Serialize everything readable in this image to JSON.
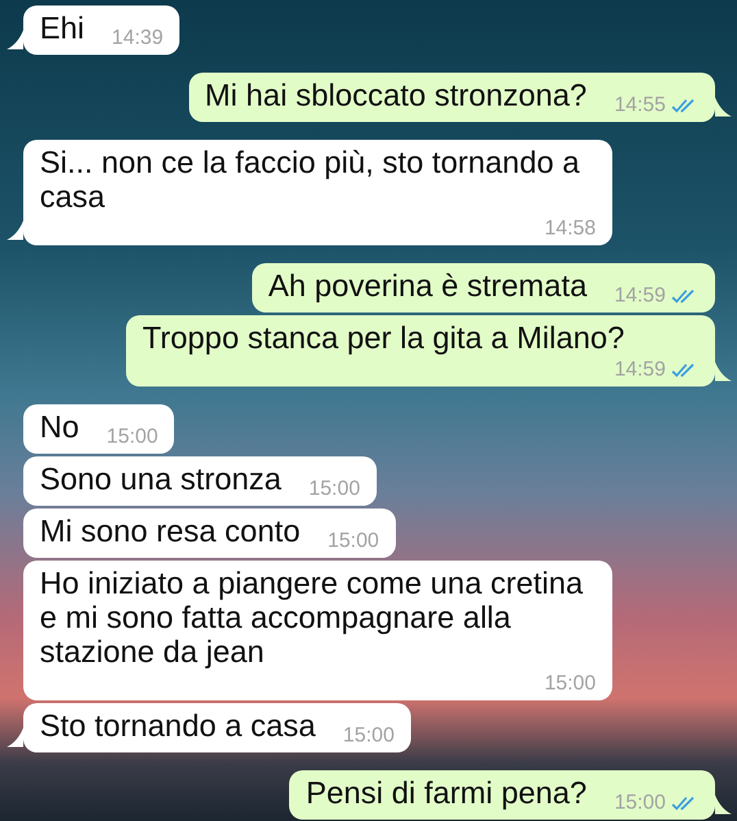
{
  "messages": [
    {
      "kind": "incoming",
      "text": "Ehi",
      "time": "14:39",
      "tail": true
    },
    {
      "kind": "outgoing",
      "text": "Mi hai sbloccato stronzona?",
      "time": "14:55",
      "read": true,
      "tail": true
    },
    {
      "kind": "incoming",
      "text": "Si... non ce la faccio più, sto tornando a casa",
      "time": "14:58",
      "tail": true
    },
    {
      "kind": "outgoing",
      "text": "Ah poverina è stremata",
      "time": "14:59",
      "read": true,
      "tail": false
    },
    {
      "kind": "outgoing",
      "text": "Troppo stanca per la gita a Milano?",
      "time": "14:59",
      "read": true,
      "tail": true
    },
    {
      "kind": "incoming",
      "text": "No",
      "time": "15:00",
      "tail": false
    },
    {
      "kind": "incoming",
      "text": "Sono una stronza",
      "time": "15:00",
      "tail": false
    },
    {
      "kind": "incoming",
      "text": "Mi sono resa conto",
      "time": "15:00",
      "tail": false
    },
    {
      "kind": "incoming",
      "text": "Ho iniziato a piangere come una cretina e mi sono fatta accompagnare alla stazione da jean",
      "time": "15:00",
      "tail": false
    },
    {
      "kind": "incoming",
      "text": "Sto tornando a casa",
      "time": "15:00",
      "tail": true
    },
    {
      "kind": "outgoing",
      "text": "Pensi di farmi pena?",
      "time": "15:00",
      "read": true,
      "tail": true
    }
  ]
}
